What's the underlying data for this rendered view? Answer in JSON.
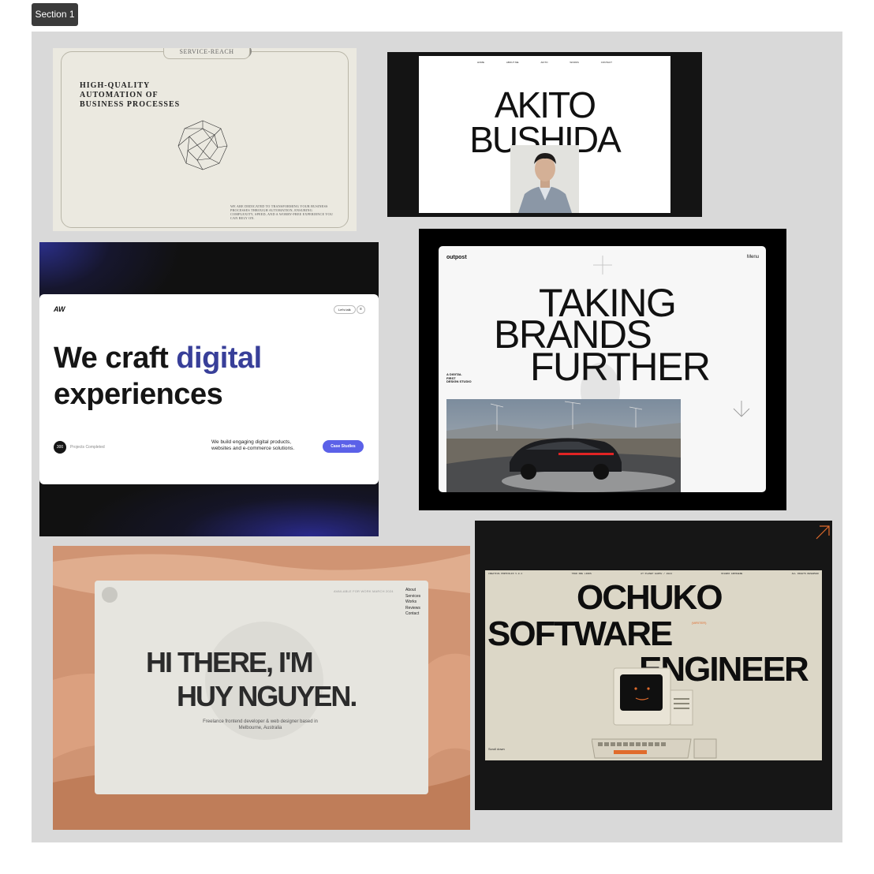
{
  "section": {
    "label": "Section 1"
  },
  "frames": {
    "service_reach": {
      "brand": "SERVICE-REACH",
      "headline": "HIGH-QUALITY\nAUTOMATION OF\nBUSINESS PROCESSES",
      "body": "WE ARE DEDICATED TO TRANSFORMING YOUR BUSINESS PROCESSES THROUGH AUTOMATION, ENSURING COMPLEXITY, SPEED, AND A WORRY-FREE EXPERIENCE YOU CAN RELY ON."
    },
    "akito": {
      "nav": [
        "HOME",
        "ABOUT ME",
        "AKITO",
        "WORKS",
        "CONTACT"
      ],
      "line1": "AKITO",
      "line2": "BUSHIDA"
    },
    "aw": {
      "logo": "AW",
      "talk_button": "Let's talk",
      "hero_plain": "We craft ",
      "hero_accent": "digital",
      "hero_line2": "experiences",
      "stat_value": "300",
      "stat_label": "Projects Completed",
      "description": "We build engaging digital products, websites and e-commerce solutions.",
      "cta": "Case Studies",
      "accent_color": "#383f99",
      "cta_color": "#5b61e8"
    },
    "outpost": {
      "logo": "outpost",
      "menu": "Menu",
      "line1": "TAKING",
      "line2": "BRANDS",
      "line3": "FURTHER",
      "tagline": "A DIGITAL\nFIRST\nDESIGN STUDIO"
    },
    "huy": {
      "available": "AVAILABLE FOR WORK MARCH 2024",
      "nav": [
        "About",
        "Services",
        "Works",
        "Reviews",
        "Contact"
      ],
      "line1": "HI THERE, I'M",
      "line2": "HUY NGUYEN.",
      "subtitle": "Freelance frontend developer & web designer based in Melbourne, Australia"
    },
    "ochuko": {
      "topbar": [
        "CREATIVE PORTFOLIO V.0.1",
        "YOUR ONE LINKS",
        "AT PLANET EARTH / 2024",
        "OCHUKO AKPOGENE",
        "ALL RIGHTS RESERVED"
      ],
      "line1": "OCHUKO",
      "line2": "SOFTWARE",
      "line3": "ENGINEER",
      "tag": "(WRITER)",
      "scroll": "Scroll down",
      "accent_color": "#e06b2c"
    }
  }
}
